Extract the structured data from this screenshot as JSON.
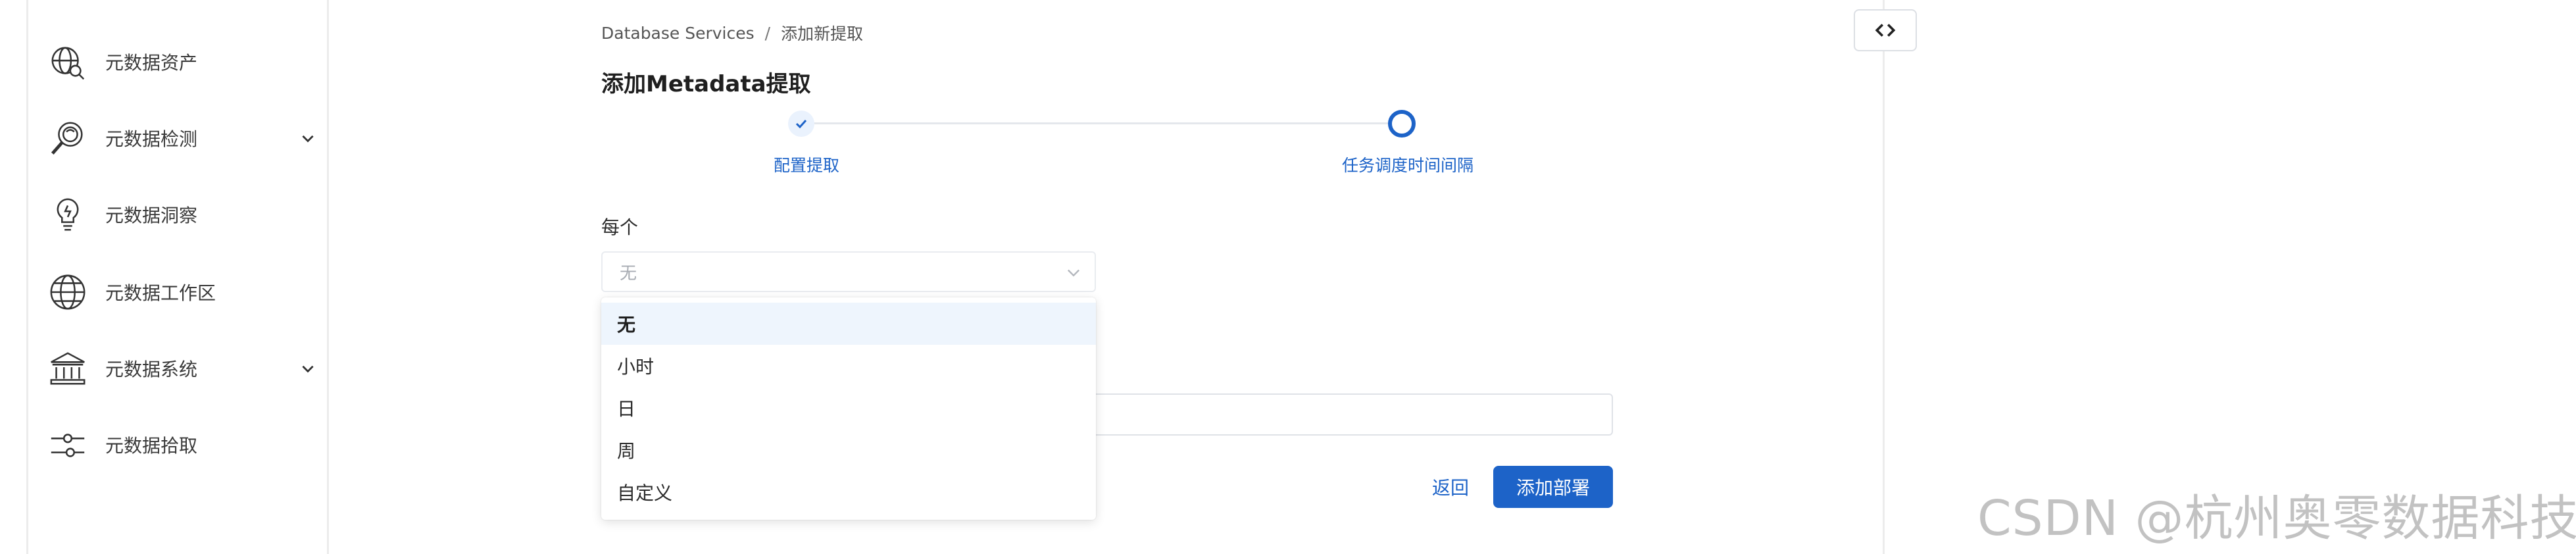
{
  "sidebar": {
    "items": [
      {
        "label": "元数据资产",
        "icon": "globe-search-icon",
        "has_chevron": false
      },
      {
        "label": "元数据检测",
        "icon": "magnifier-icon",
        "has_chevron": true
      },
      {
        "label": "元数据洞察",
        "icon": "lightbulb-icon",
        "has_chevron": false
      },
      {
        "label": "元数据工作区",
        "icon": "globe-icon",
        "has_chevron": false
      },
      {
        "label": "元数据系统",
        "icon": "bank-icon",
        "has_chevron": true
      },
      {
        "label": "元数据拾取",
        "icon": "sliders-icon",
        "has_chevron": false
      }
    ]
  },
  "breadcrumb": {
    "root": "Database Services",
    "separator": "/",
    "current": "添加新提取"
  },
  "page": {
    "title": "添加Metadata提取"
  },
  "stepper": {
    "steps": [
      {
        "label": "配置提取",
        "state": "done"
      },
      {
        "label": "任务调度时间间隔",
        "state": "active"
      }
    ]
  },
  "form": {
    "every_label": "每个",
    "select": {
      "value": "无",
      "options": [
        "无",
        "小时",
        "日",
        "周",
        "自定义"
      ],
      "selected_index": 0
    }
  },
  "actions": {
    "back_label": "返回",
    "deploy_label": "添加部署"
  },
  "watermark": "CSDN @杭州奥零数据科技",
  "colors": {
    "primary": "#1d63c8",
    "selected_option_bg": "#eef5fd",
    "placeholder": "#a8acb3"
  }
}
